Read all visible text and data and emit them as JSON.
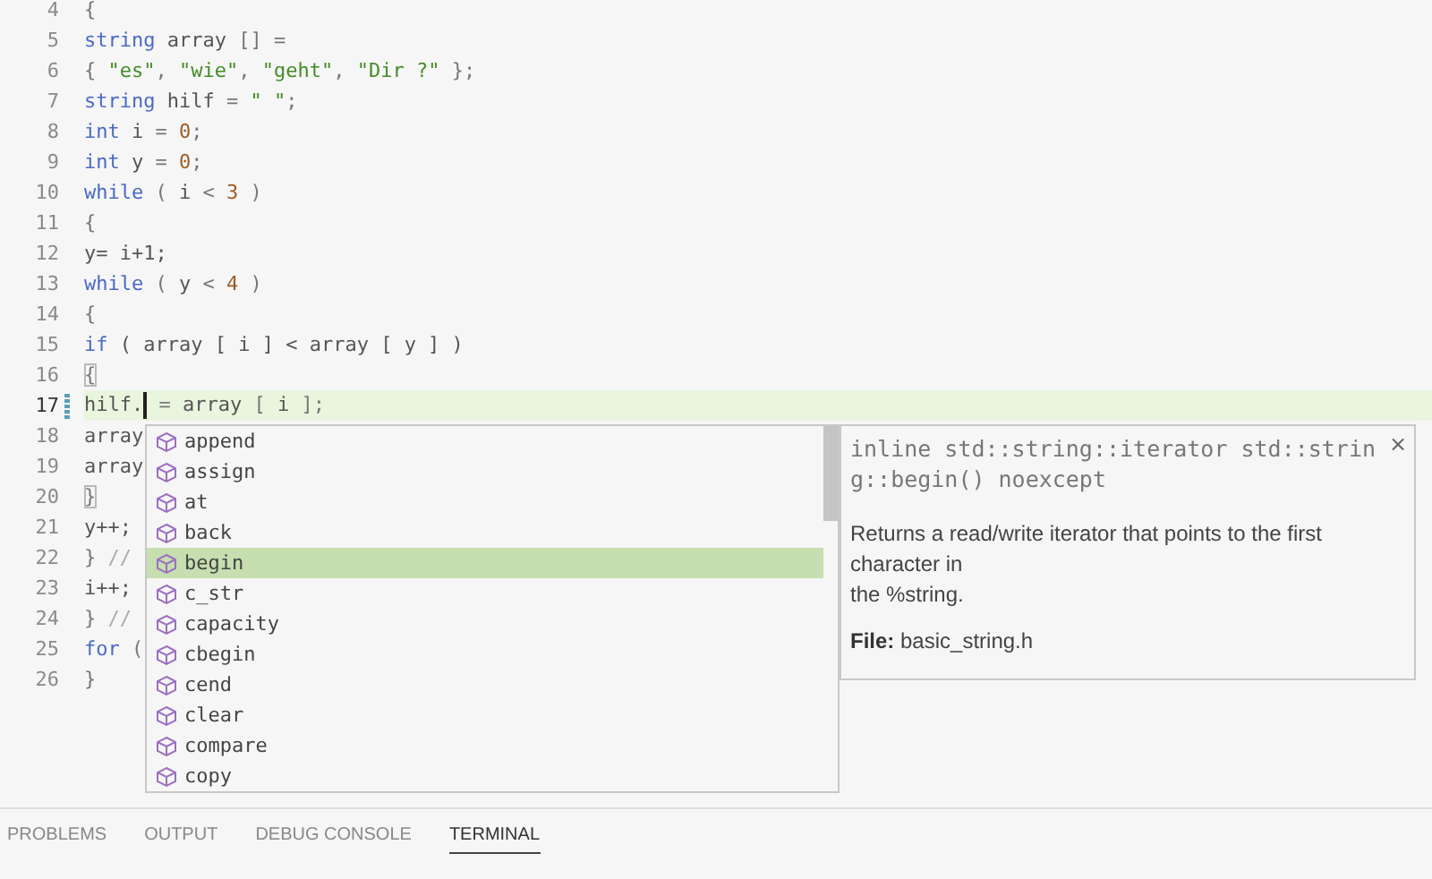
{
  "editor": {
    "lines": [
      {
        "number": "4",
        "current": false,
        "modified": false,
        "tokens": [
          {
            "text": "{",
            "kind": "punct"
          }
        ]
      },
      {
        "number": "5",
        "current": false,
        "modified": false,
        "tokens": [
          {
            "text": "string",
            "kind": "keyword"
          },
          {
            "text": " array",
            "kind": "ident"
          },
          {
            "text": " [] =",
            "kind": "punct"
          }
        ]
      },
      {
        "number": "6",
        "current": false,
        "modified": false,
        "tokens": [
          {
            "text": "{ ",
            "kind": "punct"
          },
          {
            "text": "\"es\"",
            "kind": "string"
          },
          {
            "text": ", ",
            "kind": "punct"
          },
          {
            "text": "\"wie\"",
            "kind": "string"
          },
          {
            "text": ", ",
            "kind": "punct"
          },
          {
            "text": "\"geht\"",
            "kind": "string"
          },
          {
            "text": ", ",
            "kind": "punct"
          },
          {
            "text": "\"Dir ?\"",
            "kind": "string"
          },
          {
            "text": " };",
            "kind": "punct"
          }
        ]
      },
      {
        "number": "7",
        "current": false,
        "modified": false,
        "tokens": [
          {
            "text": "string",
            "kind": "keyword"
          },
          {
            "text": " hilf",
            "kind": "ident"
          },
          {
            "text": " = ",
            "kind": "punct"
          },
          {
            "text": "\" \"",
            "kind": "string"
          },
          {
            "text": ";",
            "kind": "punct"
          }
        ]
      },
      {
        "number": "8",
        "current": false,
        "modified": false,
        "tokens": [
          {
            "text": "int",
            "kind": "keyword"
          },
          {
            "text": " i",
            "kind": "ident"
          },
          {
            "text": " = ",
            "kind": "punct"
          },
          {
            "text": "0",
            "kind": "number"
          },
          {
            "text": ";",
            "kind": "punct"
          }
        ]
      },
      {
        "number": "9",
        "current": false,
        "modified": false,
        "tokens": [
          {
            "text": "int",
            "kind": "keyword"
          },
          {
            "text": " y",
            "kind": "ident"
          },
          {
            "text": " = ",
            "kind": "punct"
          },
          {
            "text": "0",
            "kind": "number"
          },
          {
            "text": ";",
            "kind": "punct"
          }
        ]
      },
      {
        "number": "10",
        "current": false,
        "modified": false,
        "tokens": [
          {
            "text": "while",
            "kind": "keyword"
          },
          {
            "text": " ( ",
            "kind": "punct"
          },
          {
            "text": "i",
            "kind": "ident"
          },
          {
            "text": " < ",
            "kind": "punct"
          },
          {
            "text": "3",
            "kind": "number"
          },
          {
            "text": " )",
            "kind": "punct"
          }
        ]
      },
      {
        "number": "11",
        "current": false,
        "modified": false,
        "tokens": [
          {
            "text": "{",
            "kind": "punct"
          }
        ]
      },
      {
        "number": "12",
        "current": false,
        "modified": false,
        "tokens": [
          {
            "text": "y= i+1;",
            "kind": "ident"
          }
        ]
      },
      {
        "number": "13",
        "current": false,
        "modified": false,
        "tokens": [
          {
            "text": "while",
            "kind": "keyword"
          },
          {
            "text": " ( ",
            "kind": "punct"
          },
          {
            "text": "y",
            "kind": "ident"
          },
          {
            "text": " < ",
            "kind": "punct"
          },
          {
            "text": "4",
            "kind": "number"
          },
          {
            "text": " )",
            "kind": "punct"
          }
        ]
      },
      {
        "number": "14",
        "current": false,
        "modified": false,
        "tokens": [
          {
            "text": "{",
            "kind": "punct"
          }
        ]
      },
      {
        "number": "15",
        "current": false,
        "modified": false,
        "tokens": [
          {
            "text": "if",
            "kind": "keyword"
          },
          {
            "text": " ( array [ i ] < array [ y ] )",
            "kind": "ident"
          }
        ]
      },
      {
        "number": "16",
        "current": false,
        "modified": false,
        "tokens": [
          {
            "text": "{",
            "kind": "bracket"
          }
        ]
      },
      {
        "number": "17",
        "current": true,
        "modified": true,
        "tokens": [
          {
            "text": "hilf.",
            "kind": "ident",
            "caret": true
          },
          {
            "text": " = ",
            "kind": "punct"
          },
          {
            "text": "array",
            "kind": "ident"
          },
          {
            "text": " [ ",
            "kind": "punct"
          },
          {
            "text": "i",
            "kind": "ident"
          },
          {
            "text": " ];",
            "kind": "punct"
          }
        ]
      },
      {
        "number": "18",
        "current": false,
        "modified": false,
        "tokens": [
          {
            "text": "array",
            "kind": "ident"
          }
        ]
      },
      {
        "number": "19",
        "current": false,
        "modified": false,
        "tokens": [
          {
            "text": "array",
            "kind": "ident"
          }
        ]
      },
      {
        "number": "20",
        "current": false,
        "modified": false,
        "tokens": [
          {
            "text": "}",
            "kind": "bracket"
          }
        ]
      },
      {
        "number": "21",
        "current": false,
        "modified": false,
        "tokens": [
          {
            "text": "y++;",
            "kind": "ident"
          }
        ]
      },
      {
        "number": "22",
        "current": false,
        "modified": false,
        "tokens": [
          {
            "text": "}",
            "kind": "punct"
          },
          {
            "text": " //",
            "kind": "comment"
          }
        ]
      },
      {
        "number": "23",
        "current": false,
        "modified": false,
        "tokens": [
          {
            "text": "i++;",
            "kind": "ident"
          }
        ]
      },
      {
        "number": "24",
        "current": false,
        "modified": false,
        "tokens": [
          {
            "text": "}",
            "kind": "punct"
          },
          {
            "text": " //",
            "kind": "comment"
          }
        ]
      },
      {
        "number": "25",
        "current": false,
        "modified": false,
        "tokens": [
          {
            "text": "for",
            "kind": "keyword"
          },
          {
            "text": " (",
            "kind": "punct"
          }
        ]
      },
      {
        "number": "26",
        "current": false,
        "modified": false,
        "tokens": [
          {
            "text": "}",
            "kind": "punct"
          }
        ]
      }
    ]
  },
  "suggestions": [
    {
      "label": "append",
      "selected": false
    },
    {
      "label": "assign",
      "selected": false
    },
    {
      "label": "at",
      "selected": false
    },
    {
      "label": "back",
      "selected": false
    },
    {
      "label": "begin",
      "selected": true
    },
    {
      "label": "c_str",
      "selected": false
    },
    {
      "label": "capacity",
      "selected": false
    },
    {
      "label": "cbegin",
      "selected": false
    },
    {
      "label": "cend",
      "selected": false
    },
    {
      "label": "clear",
      "selected": false
    },
    {
      "label": "compare",
      "selected": false
    },
    {
      "label": "copy",
      "selected": false
    }
  ],
  "details": {
    "signature": "inline std::string::iterator std::string::begin() noexcept",
    "close": "×",
    "description_lines": [
      "Returns a read/write iterator that points to the first character in",
      "the %string."
    ],
    "file": "**File:** basic_string.h"
  },
  "panel_tabs": [
    {
      "label": "PROBLEMS",
      "selected": false
    },
    {
      "label": "OUTPUT",
      "selected": false
    },
    {
      "label": "DEBUG CONSOLE",
      "selected": false
    },
    {
      "label": "TERMINAL",
      "selected": true
    }
  ]
}
